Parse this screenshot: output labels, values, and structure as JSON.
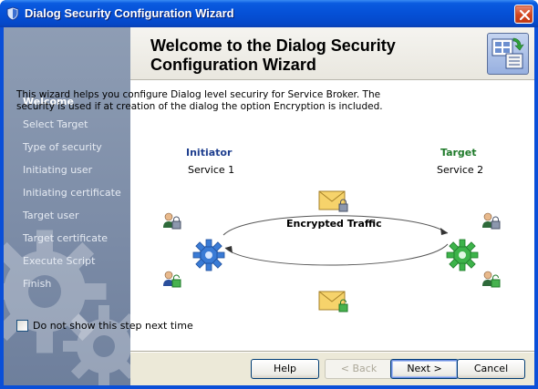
{
  "window": {
    "title": "Dialog Security Configuration Wizard"
  },
  "sidebar": {
    "items": [
      {
        "label": "Welcome",
        "active": true
      },
      {
        "label": "Select Target",
        "active": false
      },
      {
        "label": "Type of security",
        "active": false
      },
      {
        "label": "Initiating user",
        "active": false
      },
      {
        "label": "Initiating certificate",
        "active": false
      },
      {
        "label": "Target user",
        "active": false
      },
      {
        "label": "Target certificate",
        "active": false
      },
      {
        "label": "Execute Script",
        "active": false
      },
      {
        "label": "Finish",
        "active": false
      }
    ]
  },
  "header": {
    "title": "Welcome to the Dialog Security Configuration Wizard",
    "icon": "wizard-config-icon"
  },
  "description": "This wizard helps you configure Dialog level securiry for Service Broker. The security is used if at creation of the dialog the option Encryption is included.",
  "diagram": {
    "initiator_label": "Initiator",
    "initiator_service": "Service 1",
    "target_label": "Target",
    "target_service": "Service 2",
    "traffic_label": "Encrypted Traffic",
    "colors": {
      "initiator": "#1f3f8f",
      "target": "#1f7a2a"
    }
  },
  "options": {
    "dont_show_label": "Do not show this step next time",
    "dont_show_checked": false
  },
  "buttons": {
    "help": "Help",
    "back": "< Back",
    "next": "Next >",
    "cancel": "Cancel"
  }
}
